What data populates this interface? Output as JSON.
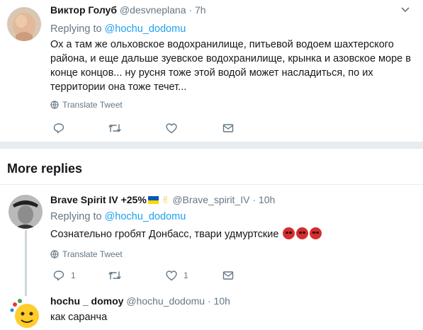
{
  "tweet1": {
    "name": "Виктор Голуб",
    "handle": "@desvneplana",
    "dot": "·",
    "time": "7h",
    "replying_prefix": "Replying to",
    "replying_to": "@hochu_dodomu",
    "text_lines": [
      "Ох а там же ольховское водохранилище, питьевой водоем шахтерского",
      "района, и еще дальше зуевское водохранилище, крынка и азовское море в",
      "конце концов... ну русня тоже этой водой может насладиться, по их",
      "территории она тоже течет..."
    ],
    "translate_label": "Translate Tweet"
  },
  "more_replies_label": "More replies",
  "tweet2": {
    "name": "Brave Spirit IV +25%",
    "emoji_hand": "✌",
    "handle": "@Brave_spirit_IV",
    "dot": "·",
    "time": "10h",
    "replying_prefix": "Replying to",
    "replying_to": "@hochu_dodomu",
    "text": "Сознательно гробят Донбасс, твари удмуртские",
    "translate_label": "Translate Tweet",
    "reply_count": "1",
    "like_count": "1"
  },
  "tweet3": {
    "name": "hochu _ domoy",
    "handle": "@hochu_dodomu",
    "dot": "·",
    "time": "10h",
    "text": "как саранча"
  },
  "colors": {
    "accent": "#1da1f2",
    "secondary_text": "#657786",
    "separator": "#e6ecf0",
    "flag_blue": "#0057b7",
    "flag_yellow": "#ffd700"
  },
  "icons": {
    "reply": "reply-icon",
    "retweet": "retweet-icon",
    "like": "like-icon",
    "message": "message-icon",
    "globe": "globe-icon",
    "caret": "chevron-down-icon"
  }
}
